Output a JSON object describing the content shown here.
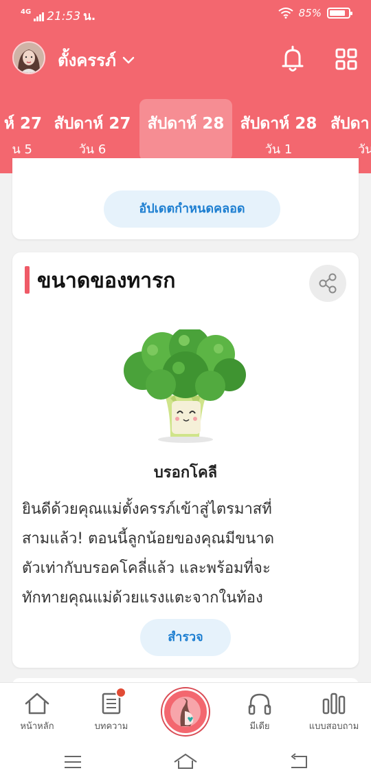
{
  "status_bar": {
    "network": "4G",
    "time": "21:53",
    "carrier_mark": "น.",
    "battery": "85%"
  },
  "header": {
    "username": "ตั้งครรภ์",
    "icons": [
      "bell-icon",
      "grid-icon"
    ],
    "weeks": [
      {
        "title": "ห์ 27",
        "day": "น 5"
      },
      {
        "title": "สัปดาห์ 27",
        "day": "วัน 6"
      },
      {
        "title": "สัปดาห์ 28",
        "day": ""
      },
      {
        "title": "สัปดาห์ 28",
        "day": "วัน 1"
      },
      {
        "title": "สัปดา",
        "day": "วัน"
      }
    ]
  },
  "due_card": {
    "button": "อัปเดตกำหนดคลอด"
  },
  "baby_size": {
    "title": "ขนาดของทารก",
    "fruit": "บรอกโคลี",
    "desc_lines": [
      "ยินดีด้วยคุณแม่ตั้งครรภ์เข้าสู่ไตรมาสที่",
      "สามแล้ว! ตอนนี้ลูกน้อยของคุณมีขนาด",
      "ตัวเท่ากับบรอคโคลี่แล้ว และพร้อมที่จะ",
      "ทักทายคุณแม่ด้วยแรงแตะจากในท้อง"
    ],
    "explore": "สำรวจ"
  },
  "bottom_nav": {
    "home": "หน้าหลัก",
    "articles": "บทความ",
    "media": "มีเดีย",
    "survey": "แบบสอบถาม"
  },
  "colors": {
    "brand": "#f3676f",
    "accent_blue": "#1e7fd1",
    "pill_bg": "#e6f2fb",
    "badge": "#e14b35"
  }
}
